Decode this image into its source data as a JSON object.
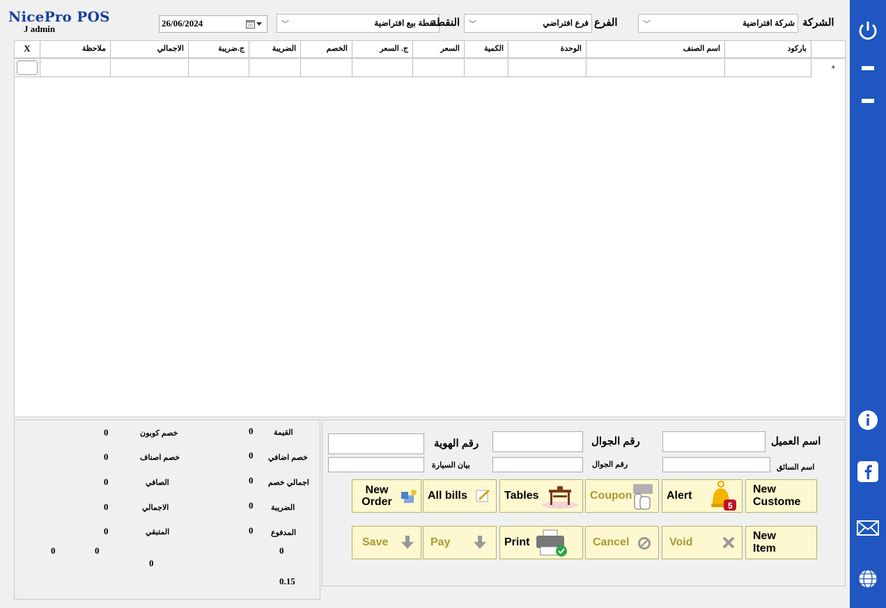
{
  "app": {
    "logo": "NicePro POS",
    "user": "J admin"
  },
  "top": {
    "date": "26/06/2024",
    "pos_label": "النقطة",
    "pos_value": "نقطة بيع افتراضية",
    "branch_label": "الفرع",
    "branch_value": "فرع افتراضي",
    "company_label": "الشركة",
    "company_value": "شركة افتراضية"
  },
  "grid": {
    "columns": [
      "X",
      "ملاحظة",
      "الاجمالي",
      "ج.ضريبة",
      "الضريبة",
      "الخصم",
      "ج. السعر",
      "السعر",
      "الكمية",
      "الوحدة",
      "اسم الصنف",
      "باركود"
    ],
    "new_row_marker": "*"
  },
  "totals": {
    "coupon_discount_label": "خصم كوبون",
    "coupon_discount": "0",
    "items_discount_label": "خصم اصناف",
    "items_discount": "0",
    "net_label": "الصافي",
    "net": "0",
    "total_label": "الاجمالي",
    "total": "0",
    "remaining_label": "المتبقي",
    "remaining": "0",
    "value_label": "القيمة",
    "value": "0",
    "extra_discount_label": "خصم اضافي",
    "extra_discount": "0",
    "total_discount_label": "اجمالي خصم",
    "total_discount": "0",
    "tax_label": "الضريبة",
    "tax": "0",
    "paid_label": "المدفوع",
    "paid": "0",
    "misc_a": "0",
    "misc_b": "0",
    "misc_c": "0",
    "misc_d": "0",
    "tax_rate": "0.15"
  },
  "customer": {
    "name_label": "اسم العميل",
    "mobile_label": "رقم الجوال",
    "id_label": "رقم الهوية",
    "driver_label": "اسم السائق",
    "driver_mobile_label": "رقم الجوال",
    "car_label": "بيان السيارة"
  },
  "buttons": {
    "new_order": "New Order",
    "all_bills": "All bills",
    "tables": "Tables",
    "coupon": "Coupon",
    "alert": "Alert",
    "alert_count": "5",
    "new_customer": "New Custome",
    "save": "Save",
    "pay": "Pay",
    "print": "Print",
    "cancel": "Cancel",
    "void": "Void",
    "new_item": "New Item"
  },
  "colors": {
    "sidebar": "#1f56c0",
    "button_bg": "#fdf8cf",
    "disabled_text": "#a69b35"
  }
}
